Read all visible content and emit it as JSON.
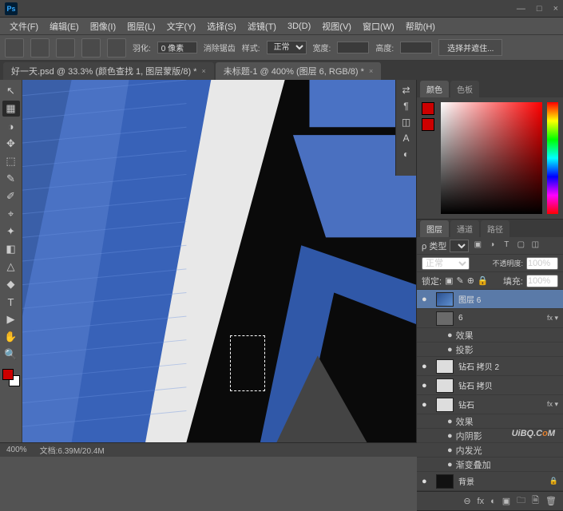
{
  "titlebar": {
    "ps": "Ps"
  },
  "window": {
    "min": "—",
    "max": "□",
    "close": "×"
  },
  "menu": [
    "文件(F)",
    "编辑(E)",
    "图像(I)",
    "图层(L)",
    "文字(Y)",
    "选择(S)",
    "滤镜(T)",
    "3D(D)",
    "视图(V)",
    "窗口(W)",
    "帮助(H)"
  ],
  "options": {
    "feather_label": "羽化:",
    "feather_value": "0 像素",
    "antialias": "消除锯齿",
    "style_label": "样式:",
    "style_value": "正常",
    "width_label": "宽度:",
    "height_label": "高度:",
    "refine": "选择并遮住..."
  },
  "tabs": [
    {
      "label": "好一天.psd @ 33.3% (颜色查找 1, 图层蒙版/8) *",
      "active": false
    },
    {
      "label": "未标题-1 @ 400% (图层 6, RGB/8) *",
      "active": true
    }
  ],
  "tools": [
    "↖",
    "▦",
    "◑",
    "✥",
    "⬚",
    "✎",
    "✐",
    "⌖",
    "✦",
    "◧",
    "△",
    "◆",
    "T",
    "▶",
    "✋",
    "🔍"
  ],
  "mini_icons": [
    "⇄",
    "¶",
    "◫",
    "A",
    "◐"
  ],
  "color_panel": {
    "tabs": [
      "颜色",
      "色板"
    ],
    "fg": "#cc0000",
    "bg": "#cc0000"
  },
  "layers_panel": {
    "tabs": [
      "图层",
      "通道",
      "路径"
    ],
    "kind_label": "ρ 类型",
    "filter_icons": [
      "▣",
      "◑",
      "T",
      "▢",
      "◫"
    ],
    "blend_mode": "正常",
    "opacity_label": "不透明度:",
    "opacity_value": "100%",
    "lock_label": "锁定:",
    "lock_icons": [
      "▣",
      "✎",
      "⊕",
      "🔒"
    ],
    "fill_label": "填充:",
    "fill_value": "100%",
    "layers": [
      {
        "vis": "●",
        "type": "blue",
        "name": "图层 6",
        "sel": true,
        "fx": false
      },
      {
        "vis": "",
        "type": "folder",
        "name": "6",
        "sel": false,
        "fx": true
      },
      {
        "sub": true,
        "name": "效果"
      },
      {
        "sub": true,
        "name": "投影"
      },
      {
        "vis": "●",
        "type": "white",
        "name": "钻石 拷贝 2",
        "sel": false,
        "fx": false
      },
      {
        "vis": "●",
        "type": "white",
        "name": "钻石 拷贝",
        "sel": false,
        "fx": false
      },
      {
        "vis": "●",
        "type": "white",
        "name": "钻石",
        "sel": false,
        "fx": true
      },
      {
        "sub": true,
        "name": "效果"
      },
      {
        "sub": true,
        "name": "内阴影"
      },
      {
        "sub": true,
        "name": "内发光"
      },
      {
        "sub": true,
        "name": "渐变叠加"
      },
      {
        "vis": "●",
        "type": "bg",
        "name": "背景",
        "sel": false,
        "lock": true
      }
    ],
    "footer_icons": [
      "⊖",
      "fx",
      "◐",
      "▣",
      "🗀",
      "🗎",
      "🗑"
    ]
  },
  "status": {
    "zoom": "400%",
    "docinfo": "文档:6.39M/20.4M"
  },
  "watermark": {
    "a": "UiBQ.C",
    "b": "o",
    "c": "M"
  }
}
